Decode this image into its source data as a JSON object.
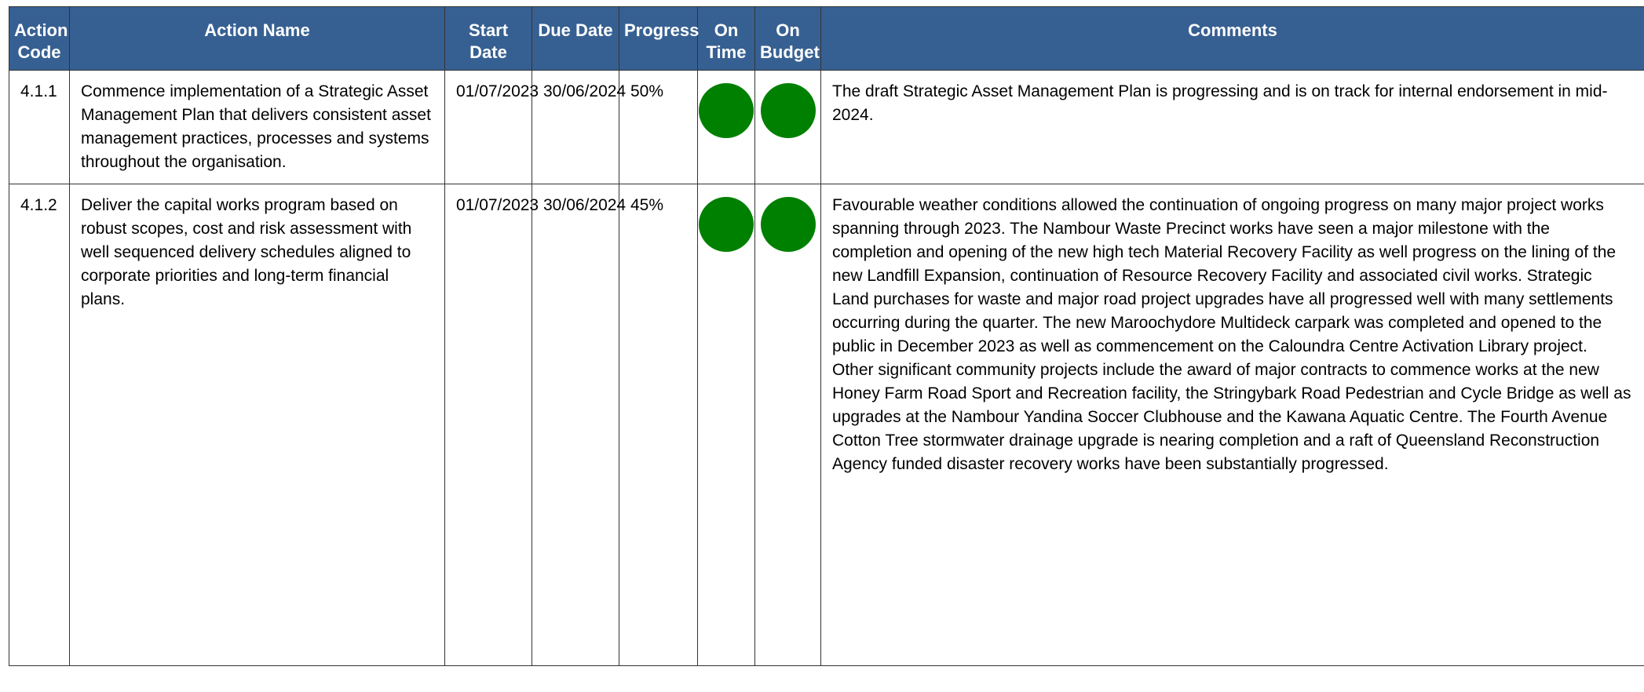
{
  "table": {
    "headers": {
      "action_code": "Action Code",
      "action_name": "Action Name",
      "start_date": "Start Date",
      "due_date": "Due Date",
      "progress": "Progress",
      "on_time": "On Time",
      "on_budget": "On Budget",
      "comments": "Comments"
    },
    "rows": [
      {
        "code": "4.1.1",
        "name": "Commence implementation of a Strategic Asset Management Plan that delivers consistent asset management practices, processes and systems throughout the organisation.",
        "start": "01/07/2023",
        "due": "30/06/2024",
        "progress": "50%",
        "on_time_status": "green",
        "on_budget_status": "green",
        "comments": "The draft Strategic Asset Management Plan is progressing and is on track for internal endorsement in mid-2024."
      },
      {
        "code": "4.1.2",
        "name": "Deliver the capital works program based on robust scopes, cost and risk assessment with well sequenced delivery schedules aligned to corporate priorities and long-term financial plans.",
        "start": "01/07/2023",
        "due": "30/06/2024",
        "progress": "45%",
        "on_time_status": "green",
        "on_budget_status": "green",
        "comments": "Favourable weather conditions allowed the continuation of ongoing progress on many major project works spanning through 2023. The Nambour Waste Precinct works have seen a major milestone with the completion and opening of the new high tech Material Recovery Facility as well progress on the lining of the new Landfill Expansion, continuation of Resource Recovery Facility and associated civil works. Strategic Land purchases for waste and major road project upgrades have all progressed well with many settlements occurring during the quarter. The new Maroochydore Multideck carpark was completed and opened to the public in December 2023 as well as commencement on the Caloundra Centre Activation Library project. Other significant community projects include the award of major contracts to commence works at the new Honey Farm Road Sport and Recreation facility, the Stringybark Road Pedestrian and Cycle Bridge as well as upgrades at the Nambour Yandina Soccer Clubhouse and the Kawana Aquatic Centre. The Fourth Avenue Cotton Tree stormwater drainage upgrade is nearing completion and a raft of Queensland Reconstruction Agency funded disaster recovery works have been substantially progressed."
      }
    ]
  },
  "colors": {
    "header_bg": "#376092",
    "header_text": "#ffffff",
    "status_green": "#008000",
    "border": "#333333"
  }
}
